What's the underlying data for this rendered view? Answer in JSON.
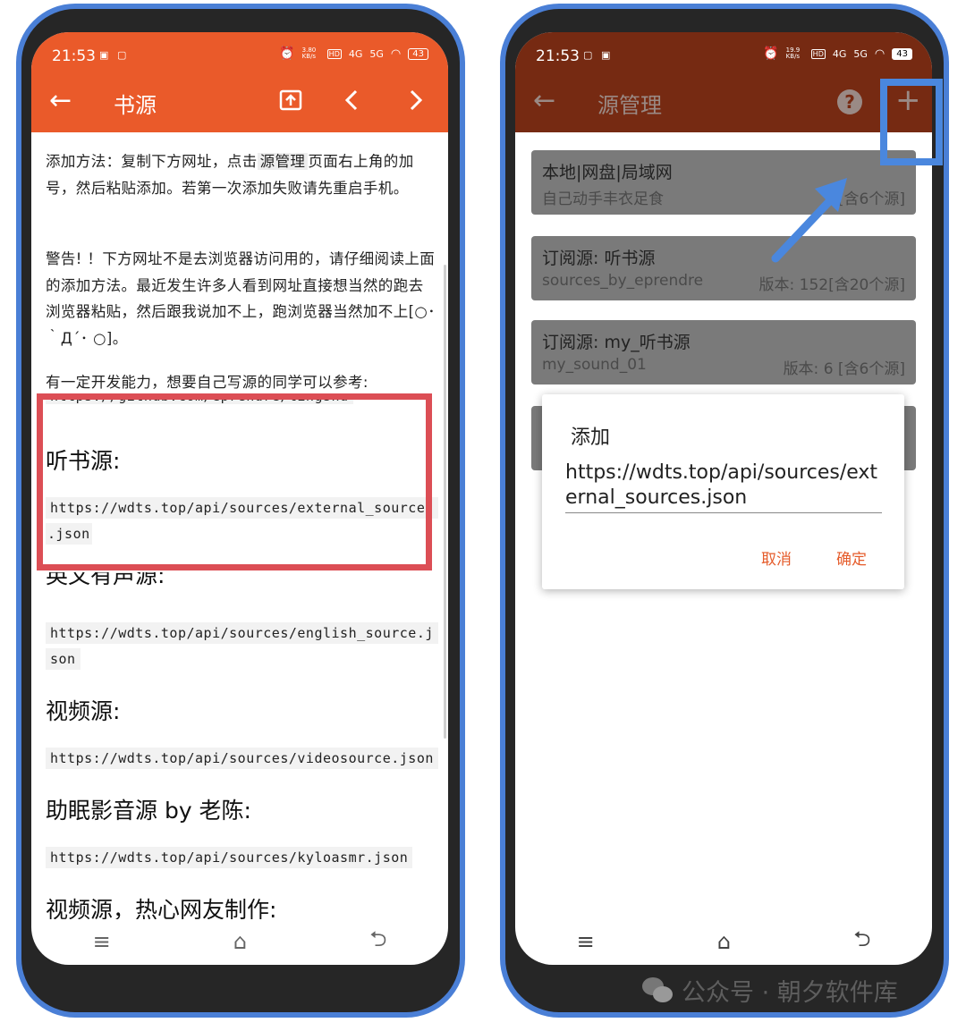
{
  "left": {
    "status": {
      "time": "21:53",
      "speed": "3.80 KB/s",
      "hd": "HD",
      "net1": "4G",
      "net2": "5G",
      "battery": "43"
    },
    "toolbar": {
      "back_icon": "arrow-left-icon",
      "title": "书源"
    },
    "intro_pre": "添加方法：复制下方网址，点击",
    "intro_code": "源管理",
    "intro_post": "页面右上角的加号，然后粘贴添加。若第一次添加失败请先重启手机。",
    "warning": "警告! ！下方网址不是去浏览器访问用的，请仔细阅读上面的添加方法。最近发生许多人看到网址直接想当然的跑去浏览器粘贴，然后跟我说加不上，跑浏览器当然加不上[○･｀Д´･ ○]。",
    "dev_note": "有一定开发能力，想要自己写源的同学可以参考:",
    "github_url": "https://github.com/eprendre/tingshu",
    "sections": [
      {
        "heading": "听书源:",
        "url_a": "https://wdts.top/api/sources/external_sources",
        "url_b": ".json"
      },
      {
        "heading": "英文有声源:",
        "url_a": "https://wdts.top/api/sources/english_source.j",
        "url_b": "son"
      },
      {
        "heading": "视频源:",
        "url_a": "https://wdts.top/api/sources/videosource.json",
        "url_b": ""
      },
      {
        "heading": "助眠影音源 by 老陈:",
        "url_a": "https://wdts.top/api/sources/kyloasmr.json",
        "url_b": ""
      },
      {
        "heading": "视频源，热心网友制作:",
        "url_a": "",
        "url_b": ""
      }
    ],
    "nav": {
      "menu": "≡",
      "home": "⌂",
      "back": "⮌"
    }
  },
  "right": {
    "status": {
      "time": "21:53",
      "speed": "19.9 KB/s",
      "hd": "HD",
      "net1": "4G",
      "net2": "5G",
      "battery": "43"
    },
    "toolbar": {
      "title": "源管理",
      "help": "?",
      "add": "+"
    },
    "cards": [
      {
        "title": "本地|网盘|局域网",
        "sub": "自己动手丰衣足食",
        "info": "[含6个源]"
      },
      {
        "title": "订阅源: 听书源",
        "sub": "sources_by_eprendre",
        "info": "版本: 152[含20个源]"
      },
      {
        "title": "订阅源: my_听书源",
        "sub": "my_sound_01",
        "info": "版本: 6 [含6个源]"
      }
    ],
    "dialog": {
      "title": "添加",
      "value": "https://wdts.top/api/sources/external_sources.json",
      "cancel": "取消",
      "ok": "确定"
    },
    "nav": {
      "menu": "≡",
      "home": "⌂",
      "back": "⮌"
    }
  },
  "watermark": "公众号 · 朝夕软件库",
  "colors": {
    "accent": "#ea5a2a",
    "dim_toolbar": "#762a12",
    "highlight_red": "#dc4e55",
    "highlight_blue": "#4a87de"
  }
}
